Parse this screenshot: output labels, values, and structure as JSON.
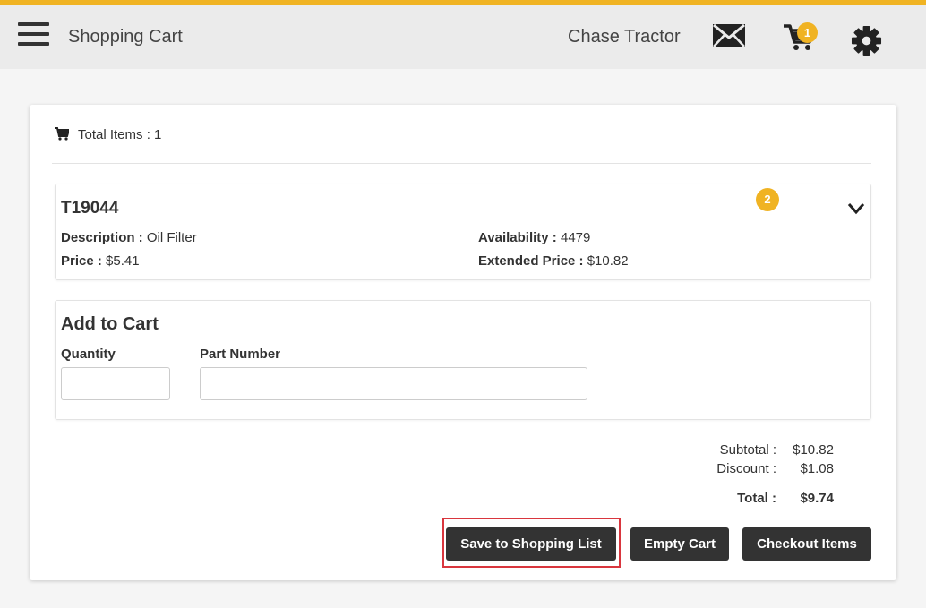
{
  "header": {
    "title": "Shopping Cart",
    "user": "Chase Tractor",
    "cart_count": "1",
    "icons": [
      "menu-icon",
      "mail-icon",
      "cart-icon",
      "gear-icon"
    ],
    "accent_color": "#f0b323"
  },
  "cart": {
    "total_items_text": "Total Items : 1"
  },
  "item": {
    "part_number": "T19044",
    "badge": "2",
    "description_label": "Description :",
    "description": "Oil Filter",
    "price_label": "Price :",
    "price": "$5.41",
    "availability_label": "Availability :",
    "availability": "4479",
    "extended_price_label": "Extended Price :",
    "extended_price": "$10.82"
  },
  "add_to_cart": {
    "title": "Add to Cart",
    "quantity_label": "Quantity",
    "quantity_value": "",
    "part_number_label": "Part Number",
    "part_number_value": ""
  },
  "totals": {
    "subtotal_label": "Subtotal :",
    "subtotal": "$10.82",
    "discount_label": "Discount :",
    "discount": "$1.08",
    "total_label": "Total :",
    "total": "$9.74"
  },
  "actions": {
    "save_label": "Save to Shopping List",
    "empty_label": "Empty Cart",
    "checkout_label": "Checkout Items"
  }
}
